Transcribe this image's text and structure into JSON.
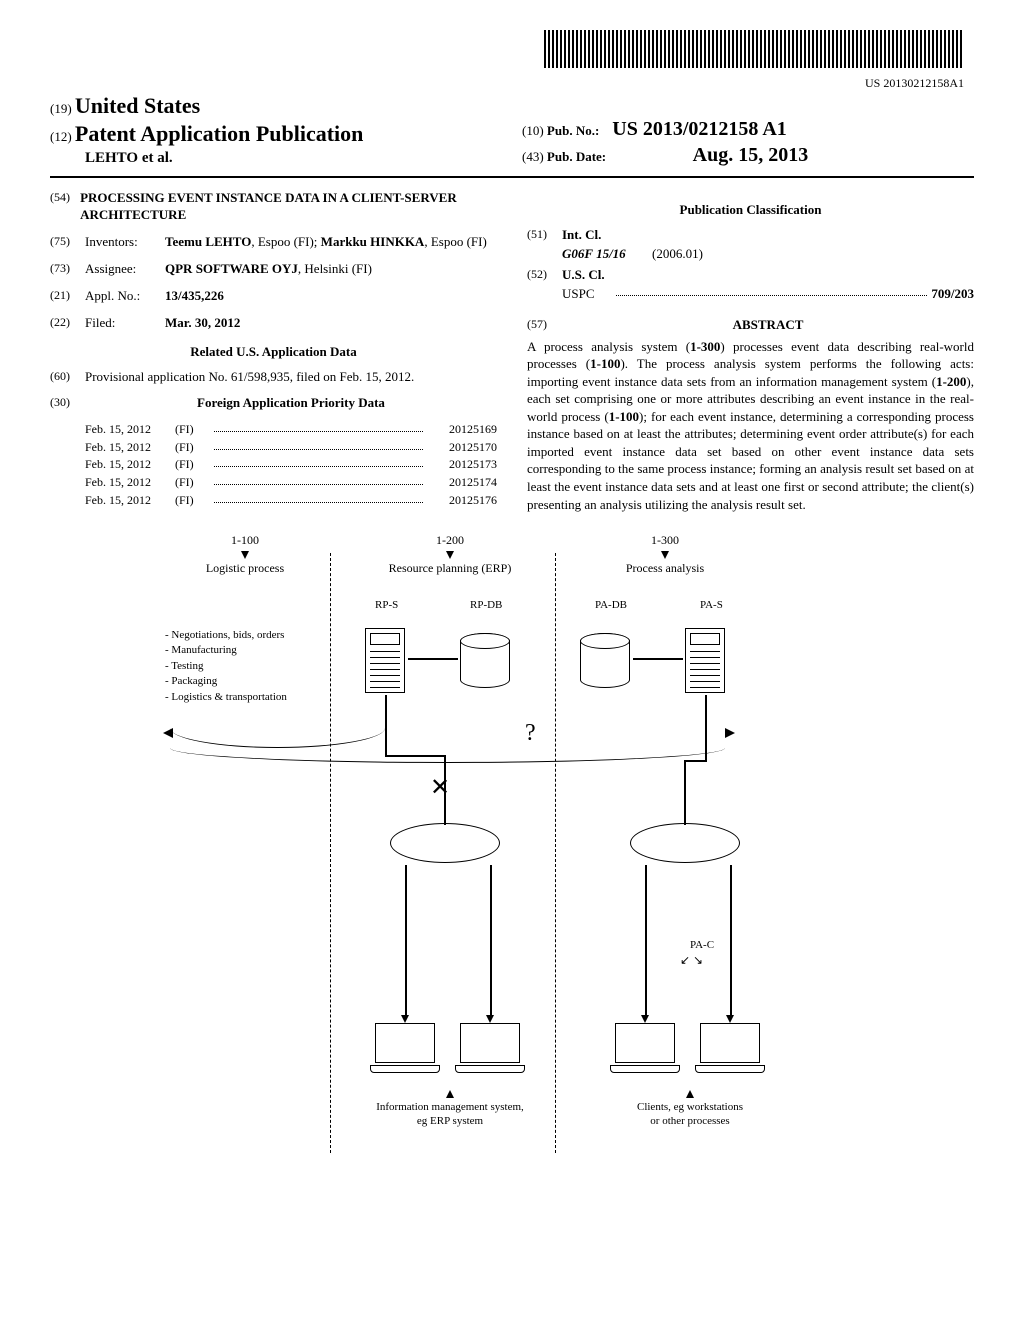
{
  "barcode_number": "US 20130212158A1",
  "header": {
    "country_num": "(19)",
    "country": "United States",
    "pub_num_code": "(12)",
    "pub_title": "Patent Application Publication",
    "authors": "LEHTO et al.",
    "pub_no_code": "(10)",
    "pub_no_label": "Pub. No.:",
    "pub_no_value": "US 2013/0212158 A1",
    "pub_date_code": "(43)",
    "pub_date_label": "Pub. Date:",
    "pub_date_value": "Aug. 15, 2013"
  },
  "left": {
    "title_code": "(54)",
    "title": "PROCESSING EVENT INSTANCE DATA IN A CLIENT-SERVER ARCHITECTURE",
    "inventors_code": "(75)",
    "inventors_label": "Inventors:",
    "inventors_value": "Teemu LEHTO, Espoo (FI); Markku HINKKA, Espoo (FI)",
    "assignee_code": "(73)",
    "assignee_label": "Assignee:",
    "assignee_value": "QPR SOFTWARE OYJ, Helsinki (FI)",
    "appl_code": "(21)",
    "appl_label": "Appl. No.:",
    "appl_value": "13/435,226",
    "filed_code": "(22)",
    "filed_label": "Filed:",
    "filed_value": "Mar. 30, 2012",
    "related_heading": "Related U.S. Application Data",
    "provisional_code": "(60)",
    "provisional_text": "Provisional application No. 61/598,935, filed on Feb. 15, 2012.",
    "foreign_code": "(30)",
    "foreign_heading": "Foreign Application Priority Data",
    "priority": [
      {
        "date": "Feb. 15, 2012",
        "country": "(FI)",
        "num": "20125169"
      },
      {
        "date": "Feb. 15, 2012",
        "country": "(FI)",
        "num": "20125170"
      },
      {
        "date": "Feb. 15, 2012",
        "country": "(FI)",
        "num": "20125173"
      },
      {
        "date": "Feb. 15, 2012",
        "country": "(FI)",
        "num": "20125174"
      },
      {
        "date": "Feb. 15, 2012",
        "country": "(FI)",
        "num": "20125176"
      }
    ]
  },
  "right": {
    "classification_heading": "Publication Classification",
    "intcl_code": "(51)",
    "intcl_label": "Int. Cl.",
    "intcl_class": "G06F 15/16",
    "intcl_year": "(2006.01)",
    "uscl_code": "(52)",
    "uscl_label": "U.S. Cl.",
    "uspc_label": "USPC",
    "uspc_value": "709/203",
    "abstract_code": "(57)",
    "abstract_heading": "ABSTRACT",
    "abstract_text": "A process analysis system (1-300) processes event data describing real-world processes (1-100). The process analysis system performs the following acts: importing event instance data sets from an information management system (1-200), each set comprising one or more attributes describing an event instance in the real-world process (1-100); for each event instance, determining a corresponding process instance based on at least the attributes; determining event order attribute(s) for each imported event instance data set based on other event instance data sets corresponding to the same process instance; forming an analysis result set based on at least the event instance data sets and at least one first or second attribute; the client(s) presenting an analysis utilizing the analysis result set."
  },
  "figure": {
    "col1_ref": "1-100",
    "col1_title": "Logistic process",
    "col2_ref": "1-200",
    "col2_title": "Resource planning (ERP)",
    "col3_ref": "1-300",
    "col3_title": "Process analysis",
    "rps": "RP-S",
    "rpdb": "RP-DB",
    "padb": "PA-DB",
    "pas": "PA-S",
    "pac": "PA-C",
    "list": [
      "- Negotiations, bids, orders",
      "- Manufacturing",
      "- Testing",
      "- Packaging",
      "- Logistics & transportation"
    ],
    "bottom_left": "Information management system,\neg ERP system",
    "bottom_right": "Clients, eg workstations\nor other processes",
    "question": "?"
  }
}
